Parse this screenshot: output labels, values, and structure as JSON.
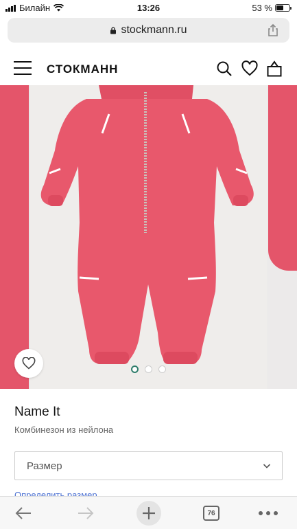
{
  "status_bar": {
    "carrier": "Билайн",
    "time": "13:26",
    "battery": "53 %",
    "battery_level": 0.53
  },
  "browser": {
    "url": "stockmann.ru",
    "tabs_count": "76"
  },
  "site": {
    "logo": "СТОКМАНН"
  },
  "gallery": {
    "slides": 3,
    "active_slide": 1
  },
  "product": {
    "brand": "Name It",
    "description": "Комбинезон из нейлона",
    "size_select_label": "Размер",
    "size_link": "Определить размер"
  },
  "colors": {
    "product": "#e4556a",
    "accent_dot": "#2e7d6b",
    "link": "#4a6fd1"
  }
}
